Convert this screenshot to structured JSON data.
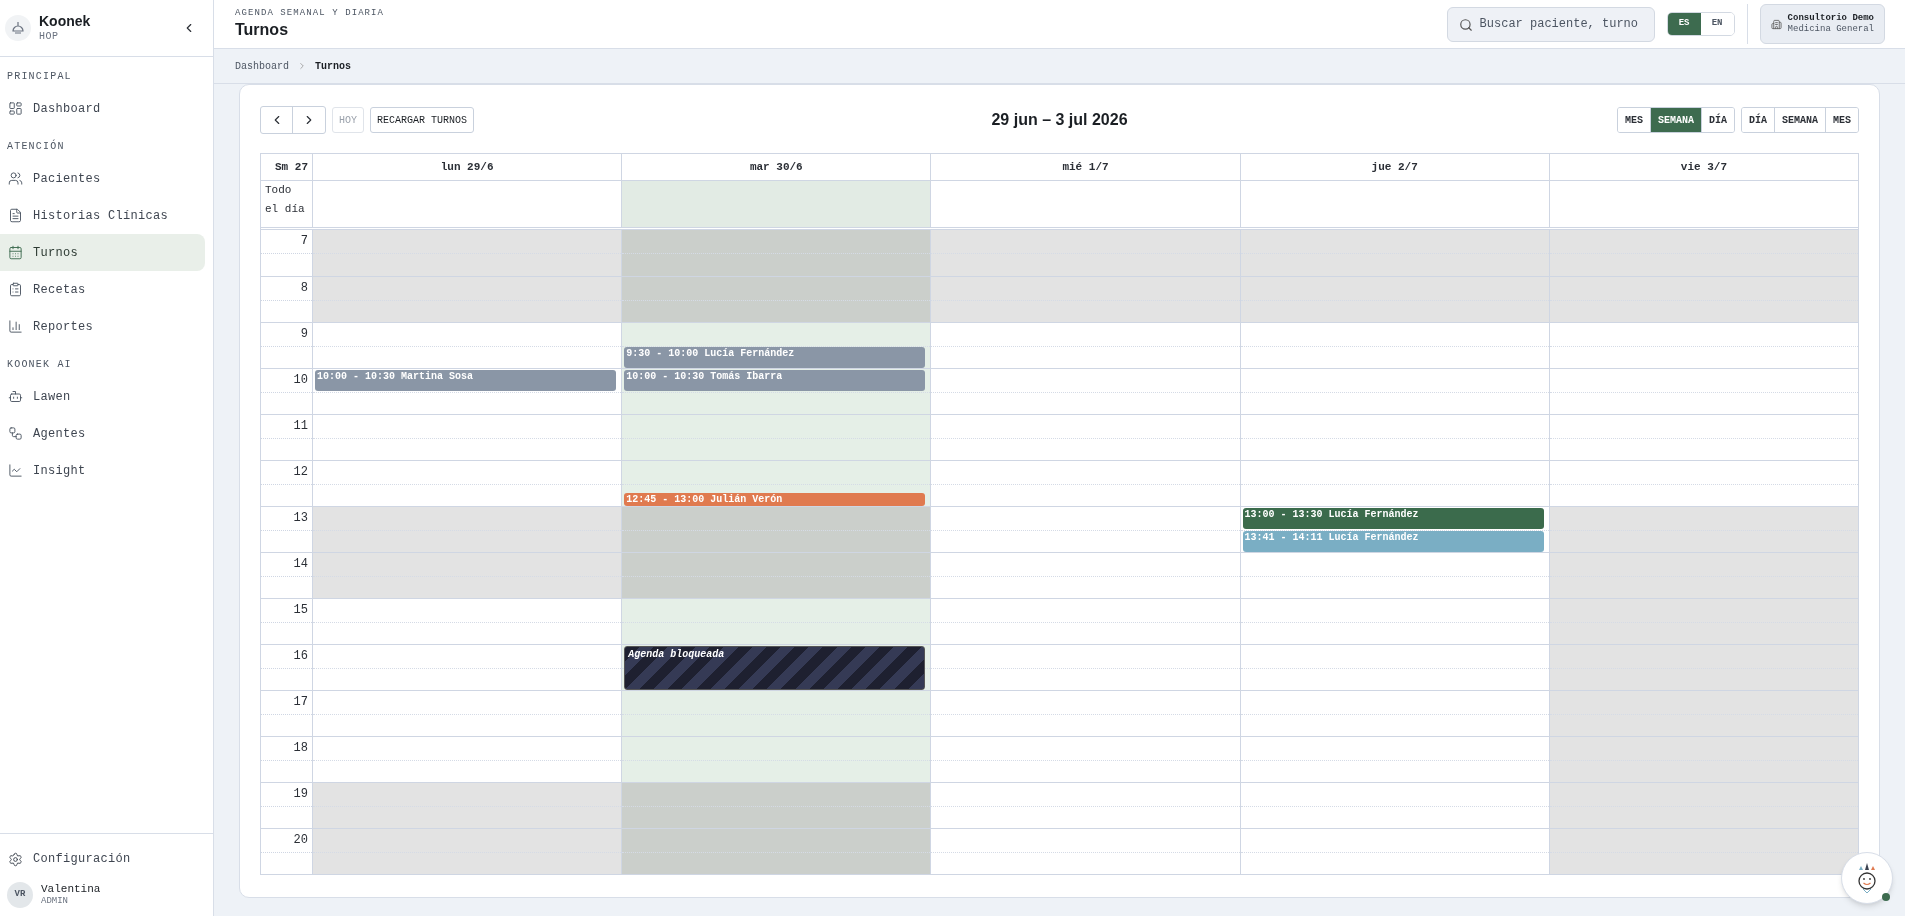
{
  "sidebar": {
    "brand": {
      "name": "Koonek",
      "subtitle": "HOP"
    },
    "sections": [
      {
        "title": "PRINCIPAL",
        "items": [
          {
            "label": "Dashboard",
            "selected": false
          }
        ]
      },
      {
        "title": "ATENCIÓN",
        "items": [
          {
            "label": "Pacientes",
            "selected": false
          },
          {
            "label": "Historias Clínicas",
            "selected": false
          },
          {
            "label": "Turnos",
            "selected": true
          },
          {
            "label": "Recetas",
            "selected": false
          },
          {
            "label": "Reportes",
            "selected": false
          }
        ]
      },
      {
        "title": "KOONEK AI",
        "items": [
          {
            "label": "Lawen",
            "selected": false
          },
          {
            "label": "Agentes",
            "selected": false
          },
          {
            "label": "Insight",
            "selected": false
          }
        ]
      }
    ],
    "settings": {
      "label": "Configuración"
    },
    "user": {
      "initials": "VR",
      "name": "Valentina",
      "role": "ADMIN"
    }
  },
  "header": {
    "eyebrow": "AGENDA SEMANAL Y DIARIA",
    "title": "Turnos",
    "search": {
      "placeholder": "Buscar paciente, turno"
    },
    "languages": [
      {
        "label": "ES",
        "selected": true
      },
      {
        "label": "EN",
        "selected": false
      }
    ],
    "clinic": {
      "name": "Consultorio Demo",
      "specialty": "Medicina General"
    }
  },
  "breadcrumb": [
    "Dashboard",
    "Turnos"
  ],
  "toolbar": {
    "today": {
      "label": "HOY",
      "disabled": true
    },
    "reload": "RECARGAR TURNOS",
    "range": "29 jun – 3 jul 2026",
    "view_groups": [
      [
        {
          "label": "MES",
          "selected": false
        },
        {
          "label": "SEMANA",
          "selected": true
        },
        {
          "label": "DÍA",
          "selected": false
        }
      ],
      [
        {
          "label": "DÍA",
          "selected": false
        },
        {
          "label": "SEMANA",
          "selected": false
        },
        {
          "label": "MES",
          "selected": false
        }
      ]
    ]
  },
  "calendar": {
    "week": "Sm 27",
    "all_day": "Todo el día",
    "hours": [
      "7",
      "8",
      "9",
      "10",
      "11",
      "12",
      "13",
      "14",
      "15",
      "16",
      "17",
      "18",
      "19",
      "20"
    ],
    "days": [
      {
        "label": "lun 29/6",
        "today": false,
        "cells": [
          {
            "shaded": true
          },
          {
            "shaded": true
          },
          {
            "shaded": false
          },
          {
            "shaded": false,
            "events": [
              {
                "kind": "appointment",
                "label": "10:00 - 10:30 Martina Sosa",
                "color": "#8a96a6"
              }
            ]
          },
          {
            "shaded": false
          },
          {
            "shaded": false
          },
          {
            "shaded": true
          },
          {
            "shaded": true
          },
          {
            "shaded": false
          },
          {
            "shaded": false
          },
          {
            "shaded": false
          },
          {
            "shaded": false
          },
          {
            "shaded": true
          },
          {
            "shaded": true
          }
        ]
      },
      {
        "label": "mar 30/6",
        "today": true,
        "cells": [
          {
            "shaded": true
          },
          {
            "shaded": true
          },
          {
            "shaded": false,
            "events": [
              {
                "kind": "appointment",
                "label": "9:30 - 10:00 Lucía Fernández",
                "color": "#8a96a6"
              }
            ]
          },
          {
            "shaded": false,
            "events": [
              {
                "kind": "appointment",
                "label": "10:00 - 10:30 Tomás Ibarra",
                "color": "#8a96a6"
              }
            ]
          },
          {
            "shaded": false
          },
          {
            "shaded": false,
            "events": [
              {
                "kind": "appointment",
                "label": "12:45 - 13:00 Julián Verón",
                "color": "#e07a4f"
              }
            ]
          },
          {
            "shaded": true
          },
          {
            "shaded": true
          },
          {
            "shaded": false
          },
          {
            "shaded": false,
            "events": [
              {
                "kind": "blocked",
                "label": "Agenda bloqueada"
              }
            ]
          },
          {
            "shaded": false
          },
          {
            "shaded": false
          },
          {
            "shaded": true
          },
          {
            "shaded": true
          }
        ]
      },
      {
        "label": "mié 1/7",
        "today": false,
        "cells": [
          {
            "shaded": true
          },
          {
            "shaded": true
          },
          {
            "shaded": false
          },
          {
            "shaded": false
          },
          {
            "shaded": false
          },
          {
            "shaded": false
          },
          {
            "shaded": false
          },
          {
            "shaded": false
          },
          {
            "shaded": false
          },
          {
            "shaded": false
          },
          {
            "shaded": false
          },
          {
            "shaded": false
          },
          {
            "shaded": false
          },
          {
            "shaded": false
          }
        ]
      },
      {
        "label": "jue 2/7",
        "today": false,
        "cells": [
          {
            "shaded": true
          },
          {
            "shaded": true
          },
          {
            "shaded": false
          },
          {
            "shaded": false
          },
          {
            "shaded": false
          },
          {
            "shaded": false
          },
          {
            "shaded": false,
            "events": [
              {
                "kind": "appointment",
                "label": "13:00 - 13:30 Lucía Fernández",
                "color": "#3b6b4c"
              },
              {
                "kind": "appointment",
                "label": "13:41 - 14:11 Lucía Fernández",
                "color": "#7aaec4"
              }
            ]
          },
          {
            "shaded": false
          },
          {
            "shaded": false
          },
          {
            "shaded": false
          },
          {
            "shaded": false
          },
          {
            "shaded": false
          },
          {
            "shaded": false
          },
          {
            "shaded": false
          }
        ]
      },
      {
        "label": "vie 3/7",
        "today": false,
        "cells": [
          {
            "shaded": true
          },
          {
            "shaded": true
          },
          {
            "shaded": false
          },
          {
            "shaded": false
          },
          {
            "shaded": false
          },
          {
            "shaded": false
          },
          {
            "shaded": true
          },
          {
            "shaded": true
          },
          {
            "shaded": true
          },
          {
            "shaded": true
          },
          {
            "shaded": true
          },
          {
            "shaded": true
          },
          {
            "shaded": true
          },
          {
            "shaded": true
          }
        ]
      }
    ]
  },
  "assistant": {
    "online": true
  }
}
